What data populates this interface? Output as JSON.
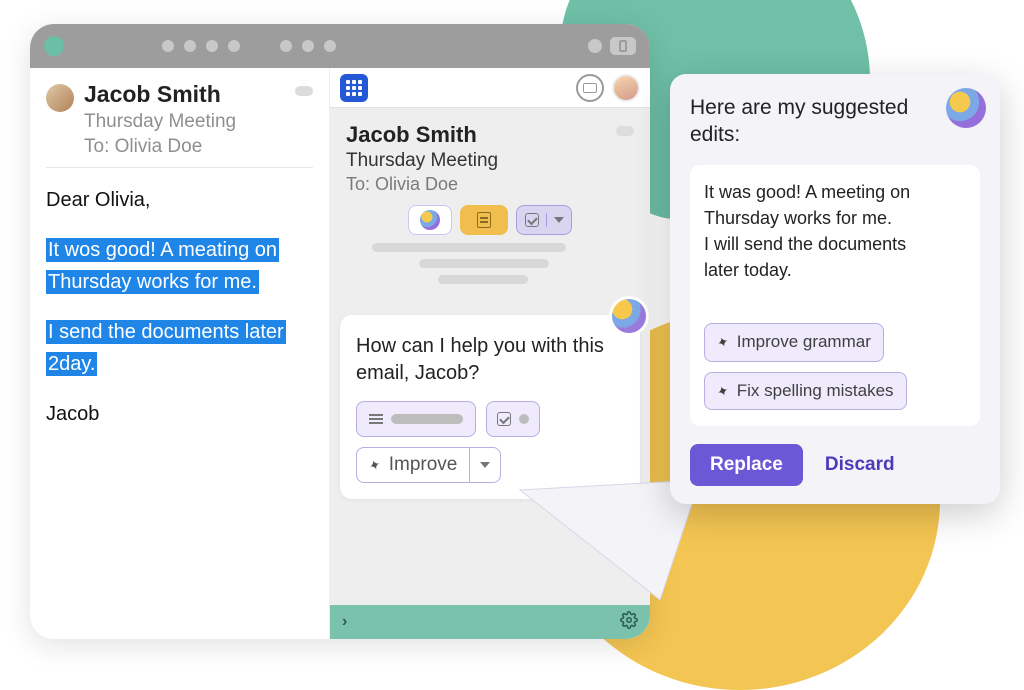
{
  "email": {
    "sender": "Jacob Smith",
    "subject": "Thursday Meeting",
    "to_line": "To: Olivia Doe",
    "greeting": "Dear Olivia,",
    "selected_para1_line1": "It wos good! A meating on",
    "selected_para1_line2": "Thursday works for me.",
    "selected_para2_line1": "I send the documents later",
    "selected_para2_line2": "2day.",
    "signoff": "Jacob"
  },
  "assistant": {
    "sender": "Jacob Smith",
    "subject": "Thursday Meeting",
    "to_line": "To: Olivia Doe",
    "prompt": "How can I help you with this email, Jacob?",
    "improve_label": "Improve"
  },
  "popover": {
    "title": "Here are my suggested edits:",
    "text_line1": "It was good! A meeting on",
    "text_line2": "Thursday works for me.",
    "text_line3": "I will send the documents",
    "text_line4": "later today.",
    "chip1": "Improve grammar",
    "chip2": "Fix spelling mistakes",
    "replace": "Replace",
    "discard": "Discard"
  }
}
